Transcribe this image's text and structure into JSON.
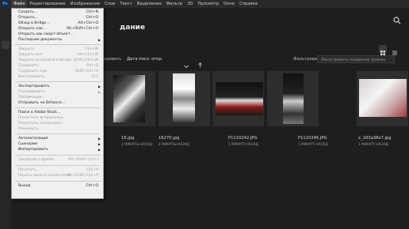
{
  "menubar": {
    "logo": "Ps",
    "items": [
      "Файл",
      "Редактирование",
      "Изображение",
      "Слои",
      "Текст",
      "Выделение",
      "Фильтр",
      "3D",
      "Просмотр",
      "Окно",
      "Справка"
    ]
  },
  "home": {
    "headline": "дание",
    "sort_label": "ировать",
    "sort_value": "Дата посл. откр.",
    "filter_label": "Фильтровать",
    "filter_placeholder": "Фильтровать недавние файлы"
  },
  "thumbnails": [
    {
      "name": "16.jpg",
      "time": "2 МИНУТЫ НАЗАД"
    },
    {
      "name": "16270.jpg",
      "time": "2 МИНУТЫ НАЗАД"
    },
    {
      "name": "P1110242.JPG",
      "time": "1 МИНУТУ НАЗАД"
    },
    {
      "name": "P1110246.JPG",
      "time": "1 МИНУТУ НАЗАД"
    },
    {
      "name": "x_183a38e7.jpg",
      "time": "1 МИНУТУ НАЗАД"
    }
  ],
  "file_menu": {
    "items": [
      {
        "label": "Создать...",
        "shortcut": "Ctrl+N",
        "disabled": false
      },
      {
        "label": "Открыть...",
        "shortcut": "Ctrl+O",
        "disabled": false
      },
      {
        "label": "Обзор в Bridge...",
        "shortcut": "Alt+Ctrl+O",
        "disabled": false
      },
      {
        "label": "Открыть как...",
        "shortcut": "Alt+Shift+Ctrl+O",
        "disabled": false
      },
      {
        "label": "Открыть как смарт-объект...",
        "shortcut": "",
        "disabled": false
      },
      {
        "label": "Последние документы",
        "shortcut": "",
        "disabled": false,
        "submenu": true
      },
      {
        "label": "Закрыть",
        "shortcut": "Ctrl+W",
        "disabled": true
      },
      {
        "label": "Закрыть все",
        "shortcut": "Alt+Ctrl+W",
        "disabled": true
      },
      {
        "label": "Закрыть и перейти в Bridge...",
        "shortcut": "Shift+Ctrl+W",
        "disabled": true
      },
      {
        "label": "Сохранить",
        "shortcut": "Ctrl+S",
        "disabled": true
      },
      {
        "label": "Сохранить как...",
        "shortcut": "Shift+Ctrl+S",
        "disabled": true
      },
      {
        "label": "Восстановить",
        "shortcut": "F12",
        "disabled": true
      },
      {
        "label": "Экспортировать",
        "shortcut": "",
        "disabled": false,
        "submenu": true
      },
      {
        "label": "Генерировать",
        "shortcut": "",
        "disabled": true,
        "submenu": true
      },
      {
        "label": "Публикация...",
        "shortcut": "",
        "disabled": true
      },
      {
        "label": "Отправить на Behance...",
        "shortcut": "",
        "disabled": false
      },
      {
        "label": "Поиск в Adobe Stock...",
        "shortcut": "",
        "disabled": false
      },
      {
        "label": "Поместить встроенные...",
        "shortcut": "",
        "disabled": true
      },
      {
        "label": "Поместить связанные...",
        "shortcut": "",
        "disabled": true
      },
      {
        "label": "Упаковать...",
        "shortcut": "",
        "disabled": true
      },
      {
        "label": "Автоматизация",
        "shortcut": "",
        "disabled": false,
        "submenu": true
      },
      {
        "label": "Сценарии",
        "shortcut": "",
        "disabled": false,
        "submenu": true
      },
      {
        "label": "Импортировать",
        "shortcut": "",
        "disabled": false,
        "submenu": true
      },
      {
        "label": "Сведения о файле...",
        "shortcut": "Alt+Shift+Ctrl+I",
        "disabled": true
      },
      {
        "label": "Печатать...",
        "shortcut": "Ctrl+P",
        "disabled": true
      },
      {
        "label": "Печать одного экземпляра",
        "shortcut": "Alt+Shift+Ctrl+P",
        "disabled": true
      },
      {
        "label": "Выход",
        "shortcut": "Ctrl+Q",
        "disabled": false
      }
    ]
  },
  "colors": {
    "menu_bg": "#f0f0f0",
    "app_bg": "#1e1e1e",
    "accent": "#31a8ff"
  }
}
